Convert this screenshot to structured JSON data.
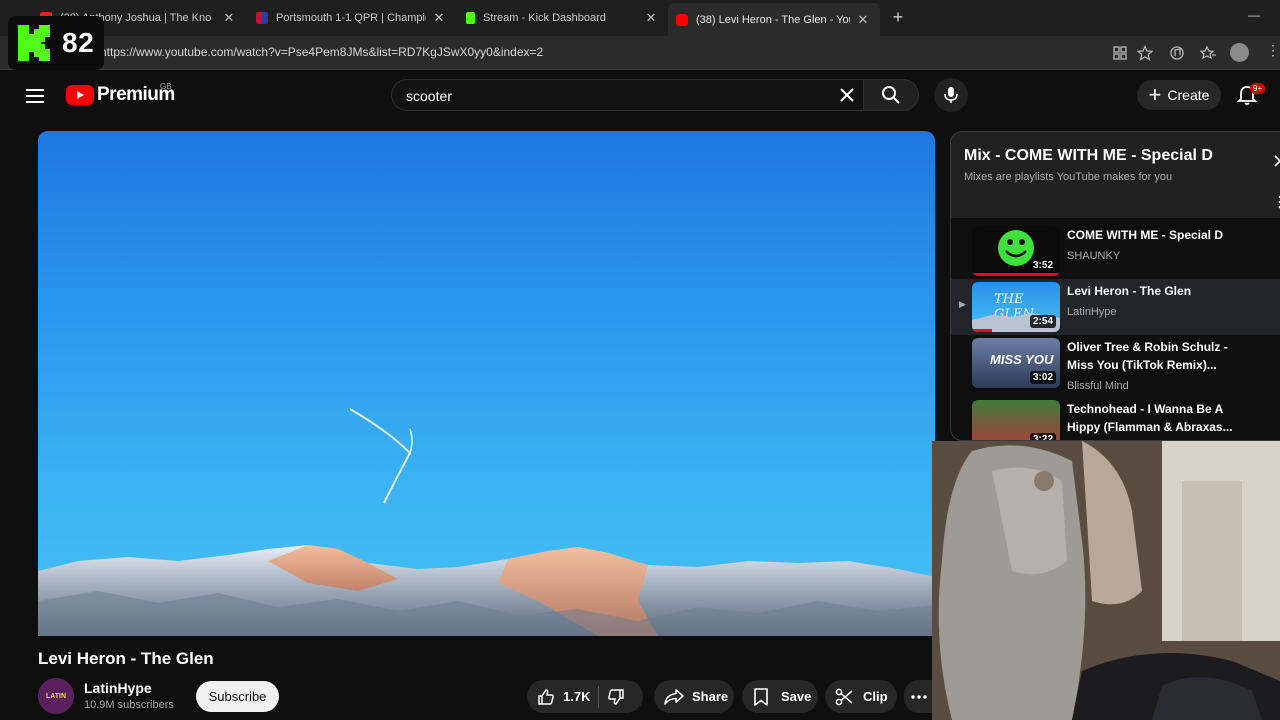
{
  "browser": {
    "tabs": [
      {
        "title": "(38) Anthony Joshua | The Kno",
        "favicon_color": "#e62117",
        "active": false
      },
      {
        "title": "Portsmouth 1-1 QPR | Championsh",
        "favicon_color": "#2a3c9e",
        "active": false
      },
      {
        "title": "Stream - Kick Dashboard",
        "favicon_color": "#53fc18",
        "active": false
      },
      {
        "title": "(38) Levi Heron - The Glen - YouTub",
        "favicon_color": "#ff0000",
        "active": true
      }
    ],
    "url": "https://www.youtube.com/watch?v=Pse4Pem8JMs&list=RD7KgJSwX0yy0&index=2",
    "close_symbol": "✕",
    "newtab_symbol": "+"
  },
  "kick_overlay": {
    "viewer_count": "82",
    "logo_color": "#53fc18"
  },
  "youtube": {
    "logo_text": "Premium",
    "region": "GB",
    "search_value": "scooter",
    "create_label": "Create",
    "notification_badge": "9+"
  },
  "video": {
    "title": "Levi Heron - The Glen",
    "channel": {
      "name": "LatinHype",
      "subscribers": "10.9M subscribers",
      "avatar_text": "LATIN"
    },
    "subscribe_label": "Subscribe",
    "actions": {
      "likes": "1.7K",
      "share": "Share",
      "save": "Save",
      "clip": "Clip"
    }
  },
  "playlist": {
    "title": "Mix - COME WITH ME - Special D",
    "subtitle": "Mixes are playlists YouTube makes for you",
    "items": [
      {
        "title": "COME WITH ME - Special D",
        "channel": "SHAUNKY",
        "duration": "3:52",
        "current": false,
        "thumb_text": ""
      },
      {
        "title": "Levi Heron - The Glen",
        "channel": "LatinHype",
        "duration": "2:54",
        "current": true,
        "thumb_text": "THE GLEN"
      },
      {
        "title": "Oliver Tree & Robin Schulz - Miss You (TikTok Remix)...",
        "channel": "Blissful Mind",
        "duration": "3:02",
        "current": false,
        "thumb_text": "MISS YOU"
      },
      {
        "title": "Technohead - I Wanna Be A Hippy (Flamman & Abraxas...",
        "channel": "",
        "duration": "3:22",
        "current": false,
        "thumb_text": ""
      }
    ],
    "playing_indicator": "▶"
  }
}
